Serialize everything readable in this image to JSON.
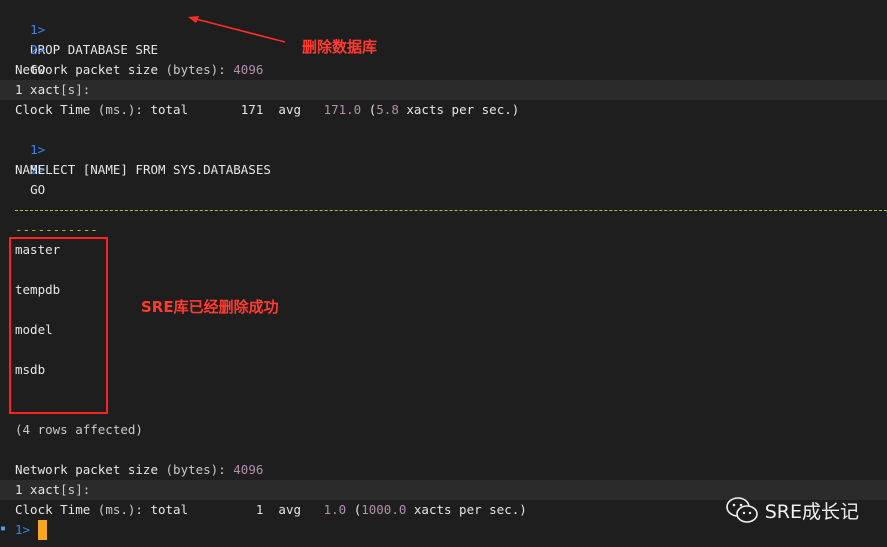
{
  "terminal": {
    "lines": {
      "l1_num": "1>",
      "l1_cmd": "DROP DATABASE SRE",
      "l2_num": "2>",
      "l2_cmd": "GO",
      "l3": "Network packet size ",
      "l3_pa": "(bytes):",
      "l3_val": "4096",
      "l4_a": "1 xact",
      "l4_b": "[s]:",
      "l5_pre": "Clock Time ",
      "l5_pa": "(ms.):",
      "l5_total": " total       171  avg   ",
      "l5_avg": "171.0",
      "l5_paren": "(",
      "l5_rate": "5.8",
      "l5_tail": " xacts per sec.)",
      "l6_num": "1>",
      "l6_cmd": "SELECT [NAME] FROM SYS.DATABASES",
      "l7_num": "2>",
      "l7_cmd": "GO",
      "l8": "NAME",
      "l9_short": "-----------",
      "rows": [
        "master",
        "tempdb",
        "model",
        "msdb"
      ],
      "affected": "(4 rows affected)",
      "l10": "Network packet size ",
      "l10_pa": "(bytes):",
      "l10_val": "4096",
      "l11_a": "1 xact",
      "l11_b": "[s]:",
      "l12_pre": "Clock Time ",
      "l12_pa": "(ms.):",
      "l12_total": " total         1  avg   ",
      "l12_avg": "1.0",
      "l12_paren": "(",
      "l12_rate": "1000.0",
      "l12_tail": " xacts per sec.)",
      "prompt": "1>"
    }
  },
  "annotations": {
    "delete_db": "删除数据库",
    "sre_deleted": "SRE库已经删除成功"
  },
  "watermark": {
    "icon": "wechat-icon",
    "text": "SRE成长记"
  },
  "colors": {
    "background": "#1e1e1e",
    "prompt_number": "#3b82f6",
    "number_value": "#b48ead",
    "dash": "#9acd32",
    "annotation": "#ff3b30",
    "cursor": "#f5a623"
  }
}
